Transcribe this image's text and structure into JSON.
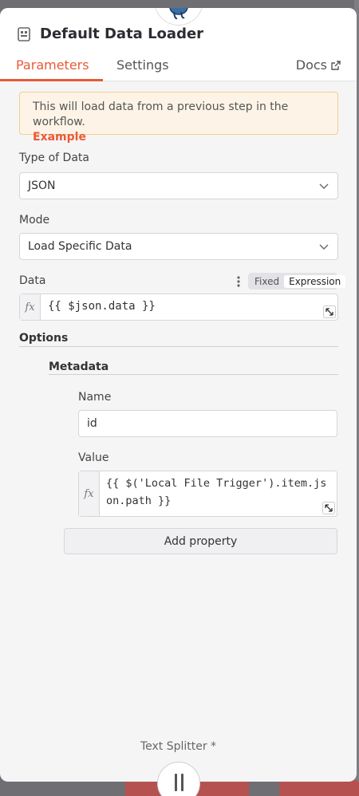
{
  "header": {
    "title": "Default Data Loader",
    "node_icon": "postgres-elephant-icon"
  },
  "tabs": [
    {
      "label": "Parameters",
      "active": true
    },
    {
      "label": "Settings",
      "active": false
    },
    {
      "label": "Docs",
      "active": false
    }
  ],
  "notice": {
    "text": "This will load data from a previous step in the workflow.",
    "link": "Example"
  },
  "fields": {
    "type_of_data": {
      "label": "Type of Data",
      "value": "JSON"
    },
    "mode": {
      "label": "Mode",
      "value": "Load Specific Data"
    },
    "data": {
      "label": "Data",
      "toggle_fixed": "Fixed",
      "toggle_expression": "Expression",
      "fx": "fx",
      "value": "{{ $json.data }}"
    }
  },
  "options": {
    "label": "Options",
    "metadata": {
      "label": "Metadata",
      "name_label": "Name",
      "name_value": "id",
      "value_label": "Value",
      "value_line1": "{{ $('Local File Trigger').item.js",
      "value_line2": "on.path }}",
      "add_property": "Add property"
    }
  },
  "footer": {
    "next_node": "Text Splitter *"
  },
  "colors": {
    "accent": "#ea5a35",
    "notice_bg": "#fdf4e7",
    "notice_border": "#f2cf8e"
  }
}
